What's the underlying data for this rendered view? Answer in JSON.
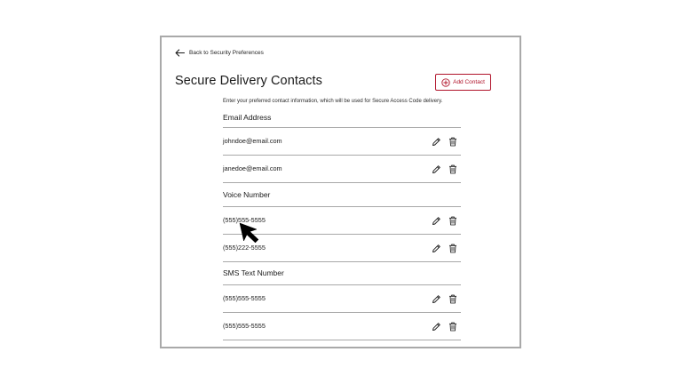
{
  "nav": {
    "back_label": "Back to Security Preferences"
  },
  "page": {
    "title": "Secure Delivery Contacts",
    "add_button_label": "Add Contact",
    "description": "Enter your preferred contact information, which will be used for Secure Access Code delivery."
  },
  "sections": [
    {
      "title": "Email Address",
      "items": [
        "johndoe@email.com",
        "janedoe@email.com"
      ]
    },
    {
      "title": "Voice Number",
      "items": [
        "(555)555-5555",
        "(555)222-5555"
      ]
    },
    {
      "title": "SMS Text Number",
      "items": [
        "(555)555-5555",
        "(555)555-5555"
      ]
    }
  ],
  "colors": {
    "accent": "#b0132a",
    "divider": "#a8a8a8",
    "border": "#a9a9a9"
  },
  "icons": {
    "back": "arrow-left-icon",
    "add": "plus-circle-icon",
    "edit": "pencil-icon",
    "delete": "trash-icon",
    "cursor": "mouse-pointer-icon"
  }
}
